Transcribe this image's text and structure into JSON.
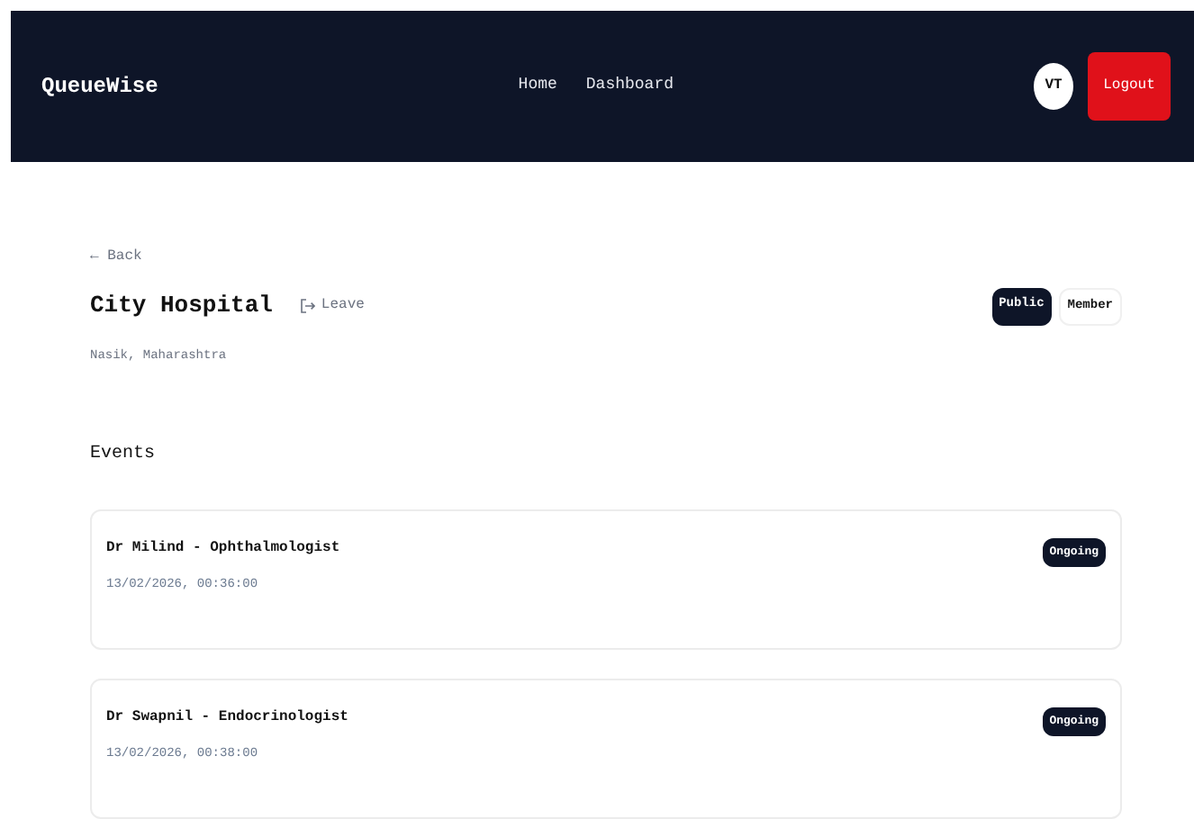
{
  "navbar": {
    "brand": "QueueWise",
    "links": [
      "Home",
      "Dashboard"
    ],
    "avatar": "VT",
    "logout": "Logout"
  },
  "back": "← Back",
  "place": {
    "name": "City Hospital",
    "leave": "Leave",
    "location": "Nasik, Maharashtra",
    "tags": [
      {
        "label": "Public",
        "filled": true
      },
      {
        "label": "Member",
        "filled": false
      }
    ]
  },
  "events_heading": "Events",
  "events": [
    {
      "title": "Dr Milind - Ophthalmologist",
      "time": "13/02/2026, 00:36:00",
      "status": "Ongoing"
    },
    {
      "title": "Dr Swapnil - Endocrinologist",
      "time": "13/02/2026, 00:38:00",
      "status": "Ongoing"
    }
  ]
}
